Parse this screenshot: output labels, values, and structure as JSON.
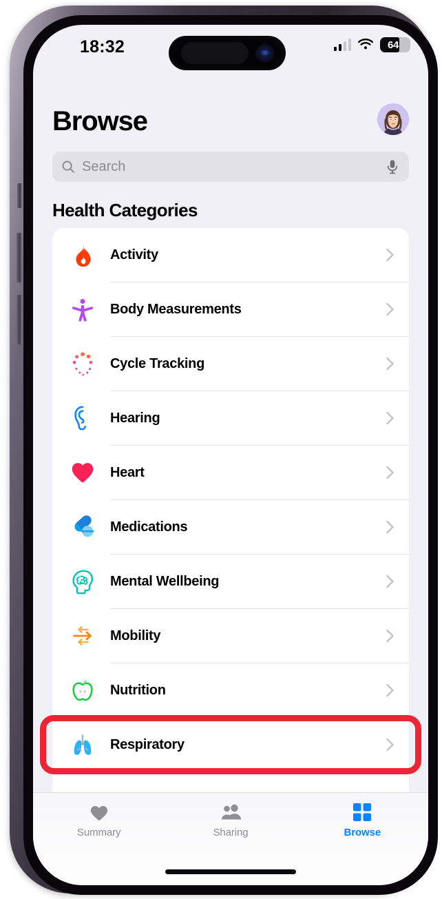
{
  "status_bar": {
    "time": "18:32",
    "battery_percent": "64",
    "battery_level": 64,
    "cellular_bars_filled": 2,
    "cellular_bars_total": 4,
    "wifi_icon": "wifi-icon",
    "battery_icon": "battery-icon"
  },
  "header": {
    "title": "Browse",
    "avatar_icon": "memoji-avatar",
    "avatar_bg": "#cfc3f2"
  },
  "search": {
    "placeholder": "Search",
    "value": "",
    "search_icon": "search-icon",
    "mic_icon": "microphone-icon"
  },
  "section": {
    "title": "Health Categories"
  },
  "categories": [
    {
      "label": "Activity",
      "icon": "flame-icon",
      "color": "#fc3c0c"
    },
    {
      "label": "Body Measurements",
      "icon": "body-figure-icon",
      "color": "#b34aec"
    },
    {
      "label": "Cycle Tracking",
      "icon": "cycle-dots-icon",
      "color": "#f0577a"
    },
    {
      "label": "Hearing",
      "icon": "ear-icon",
      "color": "#0a84ff"
    },
    {
      "label": "Heart",
      "icon": "heart-icon",
      "color": "#fa2157"
    },
    {
      "label": "Medications",
      "icon": "pills-icon",
      "color": "#0aa0e8"
    },
    {
      "label": "Mental Wellbeing",
      "icon": "brain-head-icon",
      "color": "#06c2b6"
    },
    {
      "label": "Mobility",
      "icon": "arrows-icon",
      "color": "#f79a20"
    },
    {
      "label": "Nutrition",
      "icon": "apple-icon",
      "color": "#12d03c"
    },
    {
      "label": "Respiratory",
      "icon": "lungs-icon",
      "color": "#2bb4f5"
    }
  ],
  "highlight": {
    "target_label": "Respiratory",
    "color": "#ec2534"
  },
  "tabs": [
    {
      "label": "Summary",
      "icon": "heart-icon",
      "active": false
    },
    {
      "label": "Sharing",
      "icon": "people-icon",
      "active": false
    },
    {
      "label": "Browse",
      "icon": "grid-icon",
      "active": true
    }
  ],
  "theme": {
    "background": "#f1f0f6",
    "card": "#ffffff",
    "accent": "#0a84ff",
    "muted_text": "#8e8e93"
  }
}
